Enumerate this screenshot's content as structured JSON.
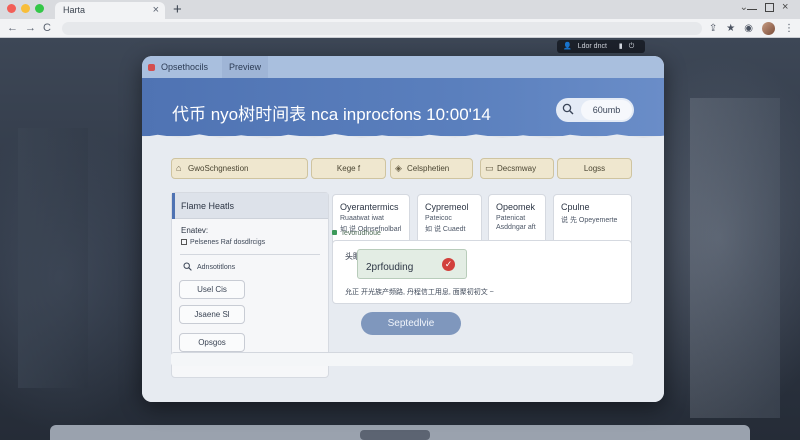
{
  "browser": {
    "tab_title": "Harta",
    "tab_close": "×",
    "new_tab": "+",
    "nav": {
      "back": "←",
      "forward": "→",
      "reload": "C"
    }
  },
  "overlay_pill": {
    "text": "Ldor dnct"
  },
  "app": {
    "tabs": [
      {
        "label": "Opsethocils"
      },
      {
        "label": "Preview"
      }
    ],
    "header": {
      "title": "代币 nyo树时间表 nca inprocfons 10:00'14",
      "search_label": "60umb"
    },
    "chips": [
      {
        "label": "GwoSchgnestion",
        "icon": "home-icon"
      },
      {
        "label": "Kege f",
        "icon": ""
      },
      {
        "label": "Celsphetien",
        "icon": "shield-icon"
      },
      {
        "label": "Decsmway",
        "icon": "folder-icon"
      },
      {
        "label": "Logss",
        "icon": ""
      }
    ],
    "left_panel": {
      "title": "Flame Heatls",
      "subtitle": "Enatev:",
      "line": "Pelsenes Raf dosdlrcigs",
      "search": "Adnsotitlons",
      "buttons": [
        "Usel Cis",
        "Jsaene Sl",
        "Opsgos"
      ]
    },
    "cards": [
      {
        "title": "Oyerantermics",
        "sub1": "Ruaatwat iwat",
        "sub2": "如 说 Odnsefnolbarl"
      },
      {
        "title": "Cypremeol",
        "sub1": "Pateicoc",
        "sub2": "如 说 Cuaedt"
      },
      {
        "title": "Opeomek",
        "sub1": "Patenicat",
        "sub2": "Asddngar aft"
      },
      {
        "title": "Cpulne",
        "sub1": "说 先 Opeyemerte",
        "sub2": ""
      }
    ],
    "result": {
      "head": "Ievorudhoue",
      "label": "头眼",
      "badge": "2prfouding",
      "footer": "允正 开光族产频路,  丹程信工用息,  面聚初初文 ~"
    },
    "primary_button": "Septedlvie"
  }
}
